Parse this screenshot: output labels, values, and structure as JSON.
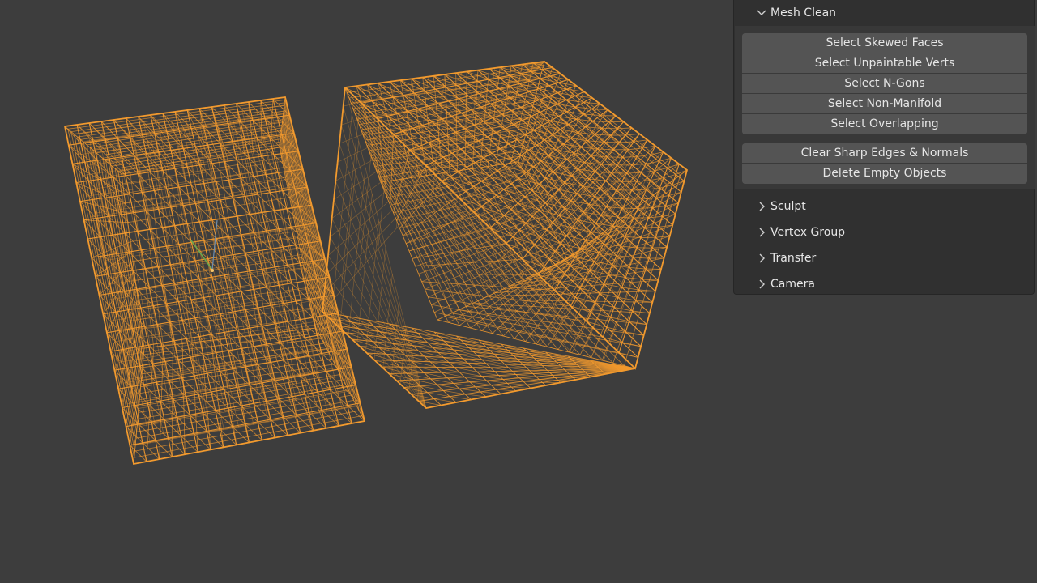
{
  "viewport": {
    "wire_color": "#f29a2e",
    "background": "#3d3d3d"
  },
  "sidebar": {
    "mesh_clean": {
      "label": "Mesh Clean",
      "expanded": true,
      "group1": [
        "Select Skewed Faces",
        "Select Unpaintable Verts",
        "Select N-Gons",
        "Select Non-Manifold",
        "Select Overlapping"
      ],
      "group2": [
        "Clear Sharp Edges & Normals",
        "Delete Empty Objects"
      ]
    },
    "panels": [
      {
        "label": "Sculpt",
        "expanded": false
      },
      {
        "label": "Vertex Group",
        "expanded": false
      },
      {
        "label": "Transfer",
        "expanded": false
      },
      {
        "label": "Camera",
        "expanded": false
      }
    ]
  }
}
